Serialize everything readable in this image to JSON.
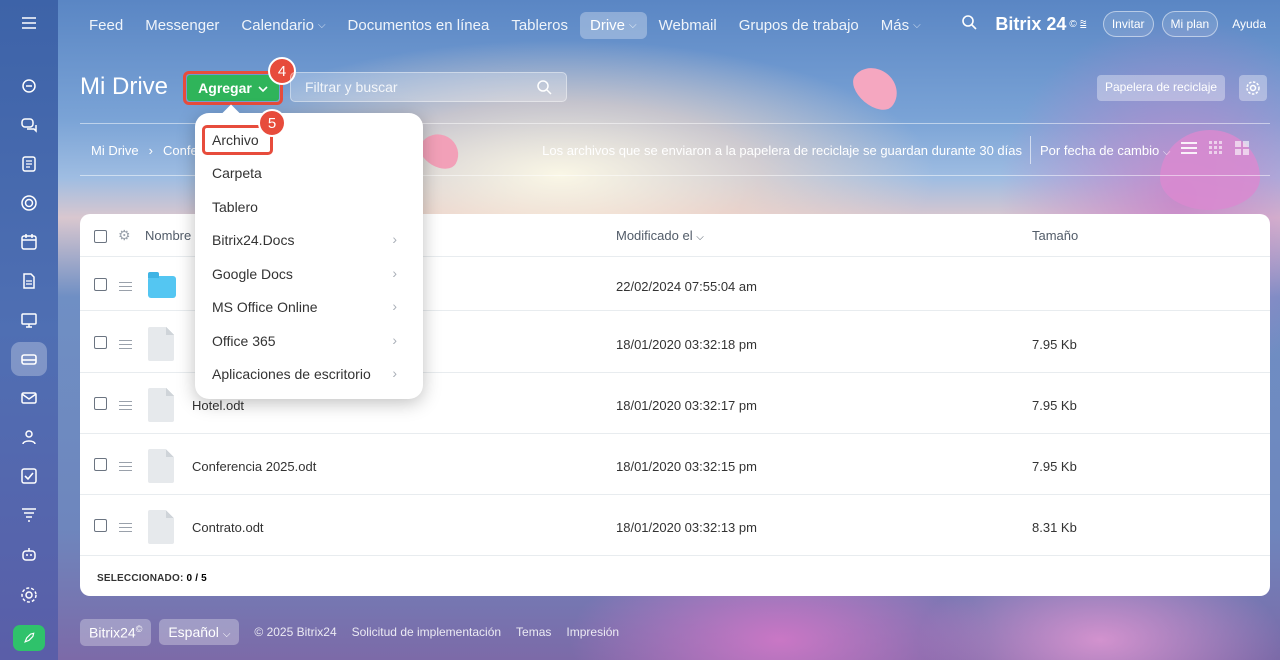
{
  "topnav": {
    "items": [
      "Feed",
      "Messenger",
      "Calendario",
      "Documentos en línea",
      "Tableros",
      "Drive",
      "Webmail",
      "Grupos de trabajo",
      "Más"
    ],
    "brand": "Bitrix 24",
    "brand_mark": "©",
    "invite": "Invitar",
    "my_plan": "Mi plan",
    "help": "Ayuda"
  },
  "page": {
    "title": "Mi Drive",
    "add_label": "Agregar",
    "search_placeholder": "Filtrar y buscar",
    "trash_label": "Papelera de reciclaje"
  },
  "badges": {
    "step4": "4",
    "step5": "5"
  },
  "breadcrumb": {
    "root": "Mi Drive",
    "current": "Confe"
  },
  "notice": "Los archivos que se enviaron a la papelera de reciclaje se guardan durante 30 días",
  "sort_label": "Por fecha de cambio",
  "table": {
    "headers": {
      "name": "Nombre",
      "modified": "Modificado el",
      "size": "Tamaño"
    },
    "rows": [
      {
        "name": "",
        "modified": "22/02/2024 07:55:04 am",
        "size": "",
        "type": "folder"
      },
      {
        "name": "",
        "modified": "18/01/2020 03:32:18 pm",
        "size": "7.95 Kb",
        "type": "file"
      },
      {
        "name": "Hotel.odt",
        "modified": "18/01/2020 03:32:17 pm",
        "size": "7.95 Kb",
        "type": "file"
      },
      {
        "name": "Conferencia 2025.odt",
        "modified": "18/01/2020 03:32:15 pm",
        "size": "7.95 Kb",
        "type": "file"
      },
      {
        "name": "Contrato.odt",
        "modified": "18/01/2020 03:32:13 pm",
        "size": "8.31 Kb",
        "type": "file"
      }
    ],
    "selected_label": "SELECCIONADO:",
    "selected_count": "0 / 5"
  },
  "dropdown": {
    "items": [
      "Archivo",
      "Carpeta",
      "Tablero",
      "Bitrix24.Docs",
      "Google Docs",
      "MS Office Online",
      "Office 365",
      "Aplicaciones de escritorio"
    ]
  },
  "footer": {
    "brand": "Bitrix24",
    "brand_mark": "©",
    "language": "Español",
    "copyright": "© 2025 Bitrix24",
    "link1": "Solicitud de implementación",
    "link2": "Temas",
    "link3": "Impresión"
  },
  "colors": {
    "accent_green": "#2fb45a",
    "highlight_red": "#e74c3c",
    "folder_blue": "#54c6f2"
  }
}
